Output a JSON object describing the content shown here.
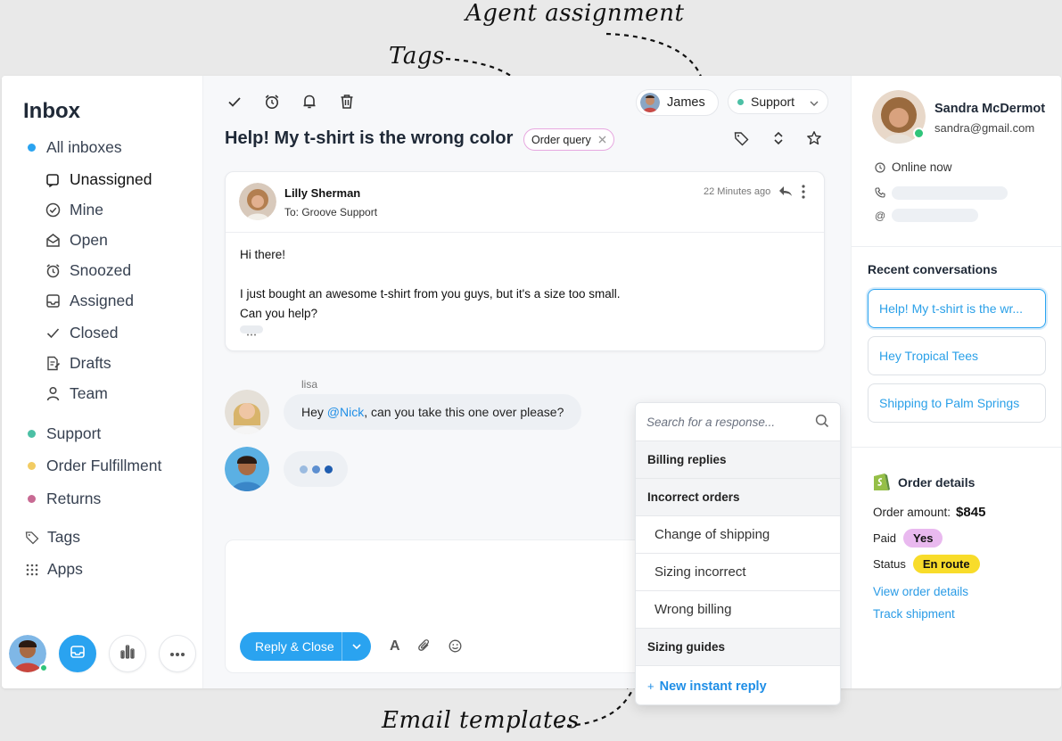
{
  "annotations": {
    "agent_assignment": "Agent assignment",
    "tags": "Tags",
    "email_templates": "Email templates"
  },
  "sidebar": {
    "title": "Inbox",
    "all_inboxes": "All inboxes",
    "items": [
      {
        "label": "Unassigned",
        "icon": "inbox-tray-icon"
      },
      {
        "label": "Mine",
        "icon": "check-circle-icon"
      },
      {
        "label": "Open",
        "icon": "open-envelope-icon"
      },
      {
        "label": "Snoozed",
        "icon": "alarm-clock-icon"
      },
      {
        "label": "Assigned",
        "icon": "assigned-tray-icon"
      },
      {
        "label": "Closed",
        "icon": "checkmark-icon"
      },
      {
        "label": "Drafts",
        "icon": "draft-document-icon"
      },
      {
        "label": "Team",
        "icon": "person-icon"
      }
    ],
    "mailboxes": [
      {
        "label": "Support",
        "color": "#4cc0a5"
      },
      {
        "label": "Order Fulfillment",
        "color": "#f2cc63"
      },
      {
        "label": "Returns",
        "color": "#c86a93"
      }
    ],
    "tags_label": "Tags",
    "apps_label": "Apps"
  },
  "conversation": {
    "subject": "Help! My t-shirt is the wrong color",
    "tag": "Order query",
    "agent": "James",
    "mailbox": "Support",
    "message": {
      "sender": "Lilly Sherman",
      "to": "To: Groove Support",
      "time": "22 Minutes ago",
      "greeting": "Hi there!",
      "line1": "I just bought an awesome t-shirt from you guys, but it's a size too small.",
      "line2": "Can you help?"
    },
    "note": {
      "author": "lisa",
      "before": "Hey ",
      "mention": "@Nick",
      "after": ", can you take this one over please?"
    }
  },
  "composer": {
    "reply_label": "Reply & Close"
  },
  "responses": {
    "search_placeholder": "Search for a response...",
    "groups": [
      {
        "label": "Billing replies",
        "items": []
      },
      {
        "label": "Incorrect orders",
        "items": [
          "Change of shipping",
          "Sizing incorrect",
          "Wrong billing"
        ]
      },
      {
        "label": "Sizing guides",
        "items": []
      }
    ],
    "new_label": "New instant reply"
  },
  "customer": {
    "name": "Sandra McDermot",
    "email": "sandra@gmail.com",
    "status": "Online now",
    "recent_title": "Recent conversations",
    "recent": [
      "Help! My t-shirt is the wr...",
      "Hey Tropical Tees",
      "Shipping to Palm Springs"
    ],
    "order": {
      "title": "Order details",
      "amount_label": "Order amount:",
      "amount": "$845",
      "paid_label": "Paid",
      "paid_value": "Yes",
      "status_label": "Status",
      "status_value": "En route",
      "view_link": "View order details",
      "track_link": "Track shipment"
    }
  },
  "colors": {
    "accent": "#2aa3f0",
    "tag_border": "#e7a8e0",
    "paid_badge": "#e9b9ef",
    "status_badge": "#f8dc2a"
  }
}
